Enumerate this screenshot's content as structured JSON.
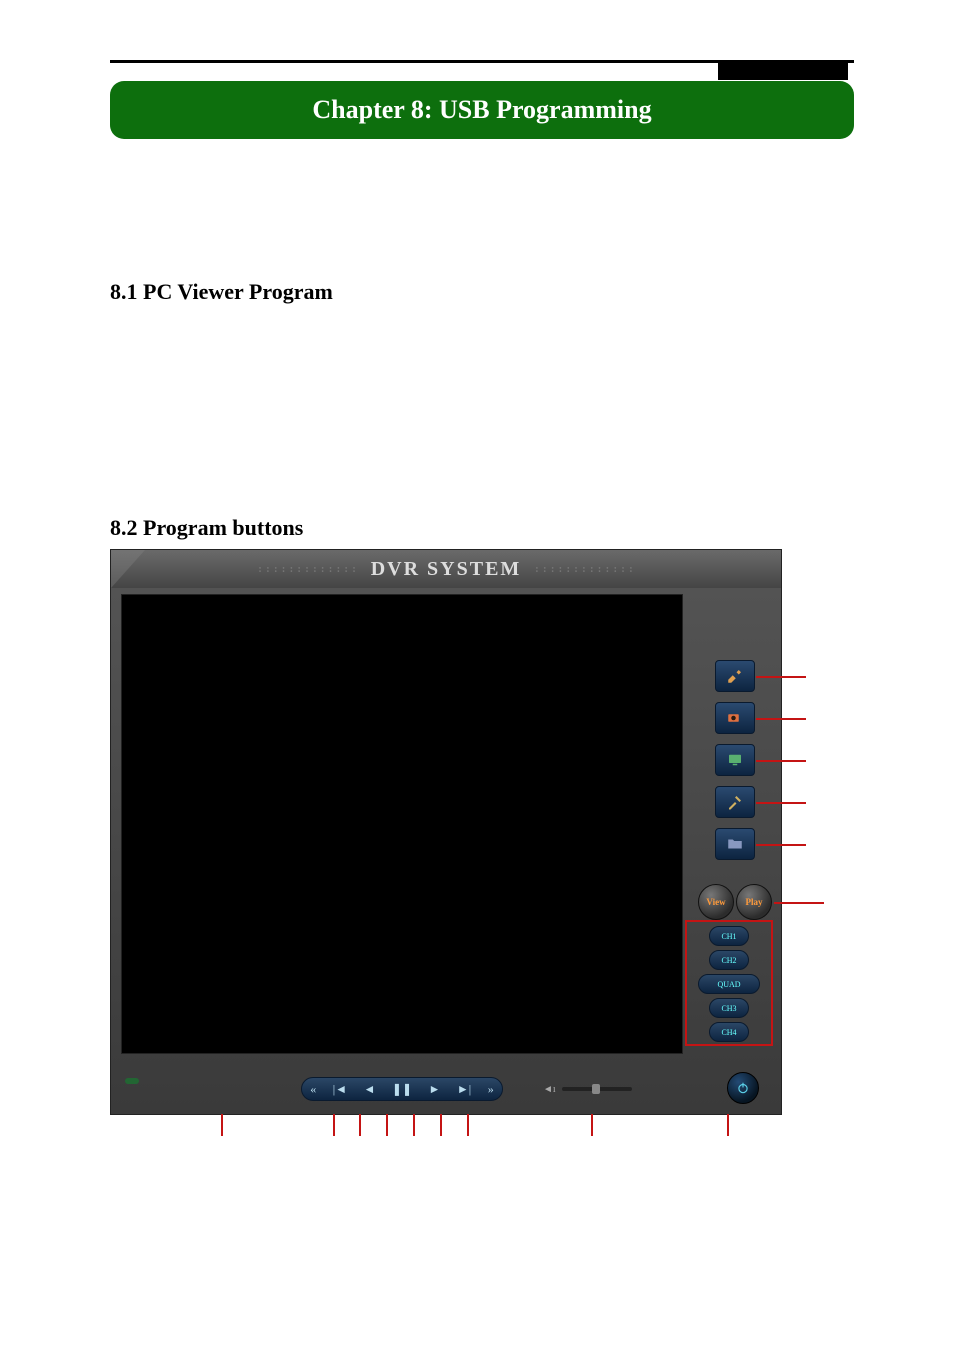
{
  "chapter_title": "Chapter 8: USB Programming",
  "section_1": "8.1 PC Viewer Program",
  "section_2": "8.2 Program buttons",
  "dvr": {
    "title": "DVR SYSTEM",
    "tool_icons": [
      "paint-icon",
      "camera-icon",
      "monitor-icon",
      "tools-icon",
      "folder-icon"
    ],
    "view_label": "View",
    "play_label": "Play",
    "channels": [
      "CH1",
      "CH2",
      "QUAD",
      "CH3",
      "CH4"
    ],
    "playback_icons": [
      "rewind-fast",
      "prev",
      "step-back",
      "pause",
      "step-fwd",
      "next",
      "ffwd-fast"
    ]
  }
}
